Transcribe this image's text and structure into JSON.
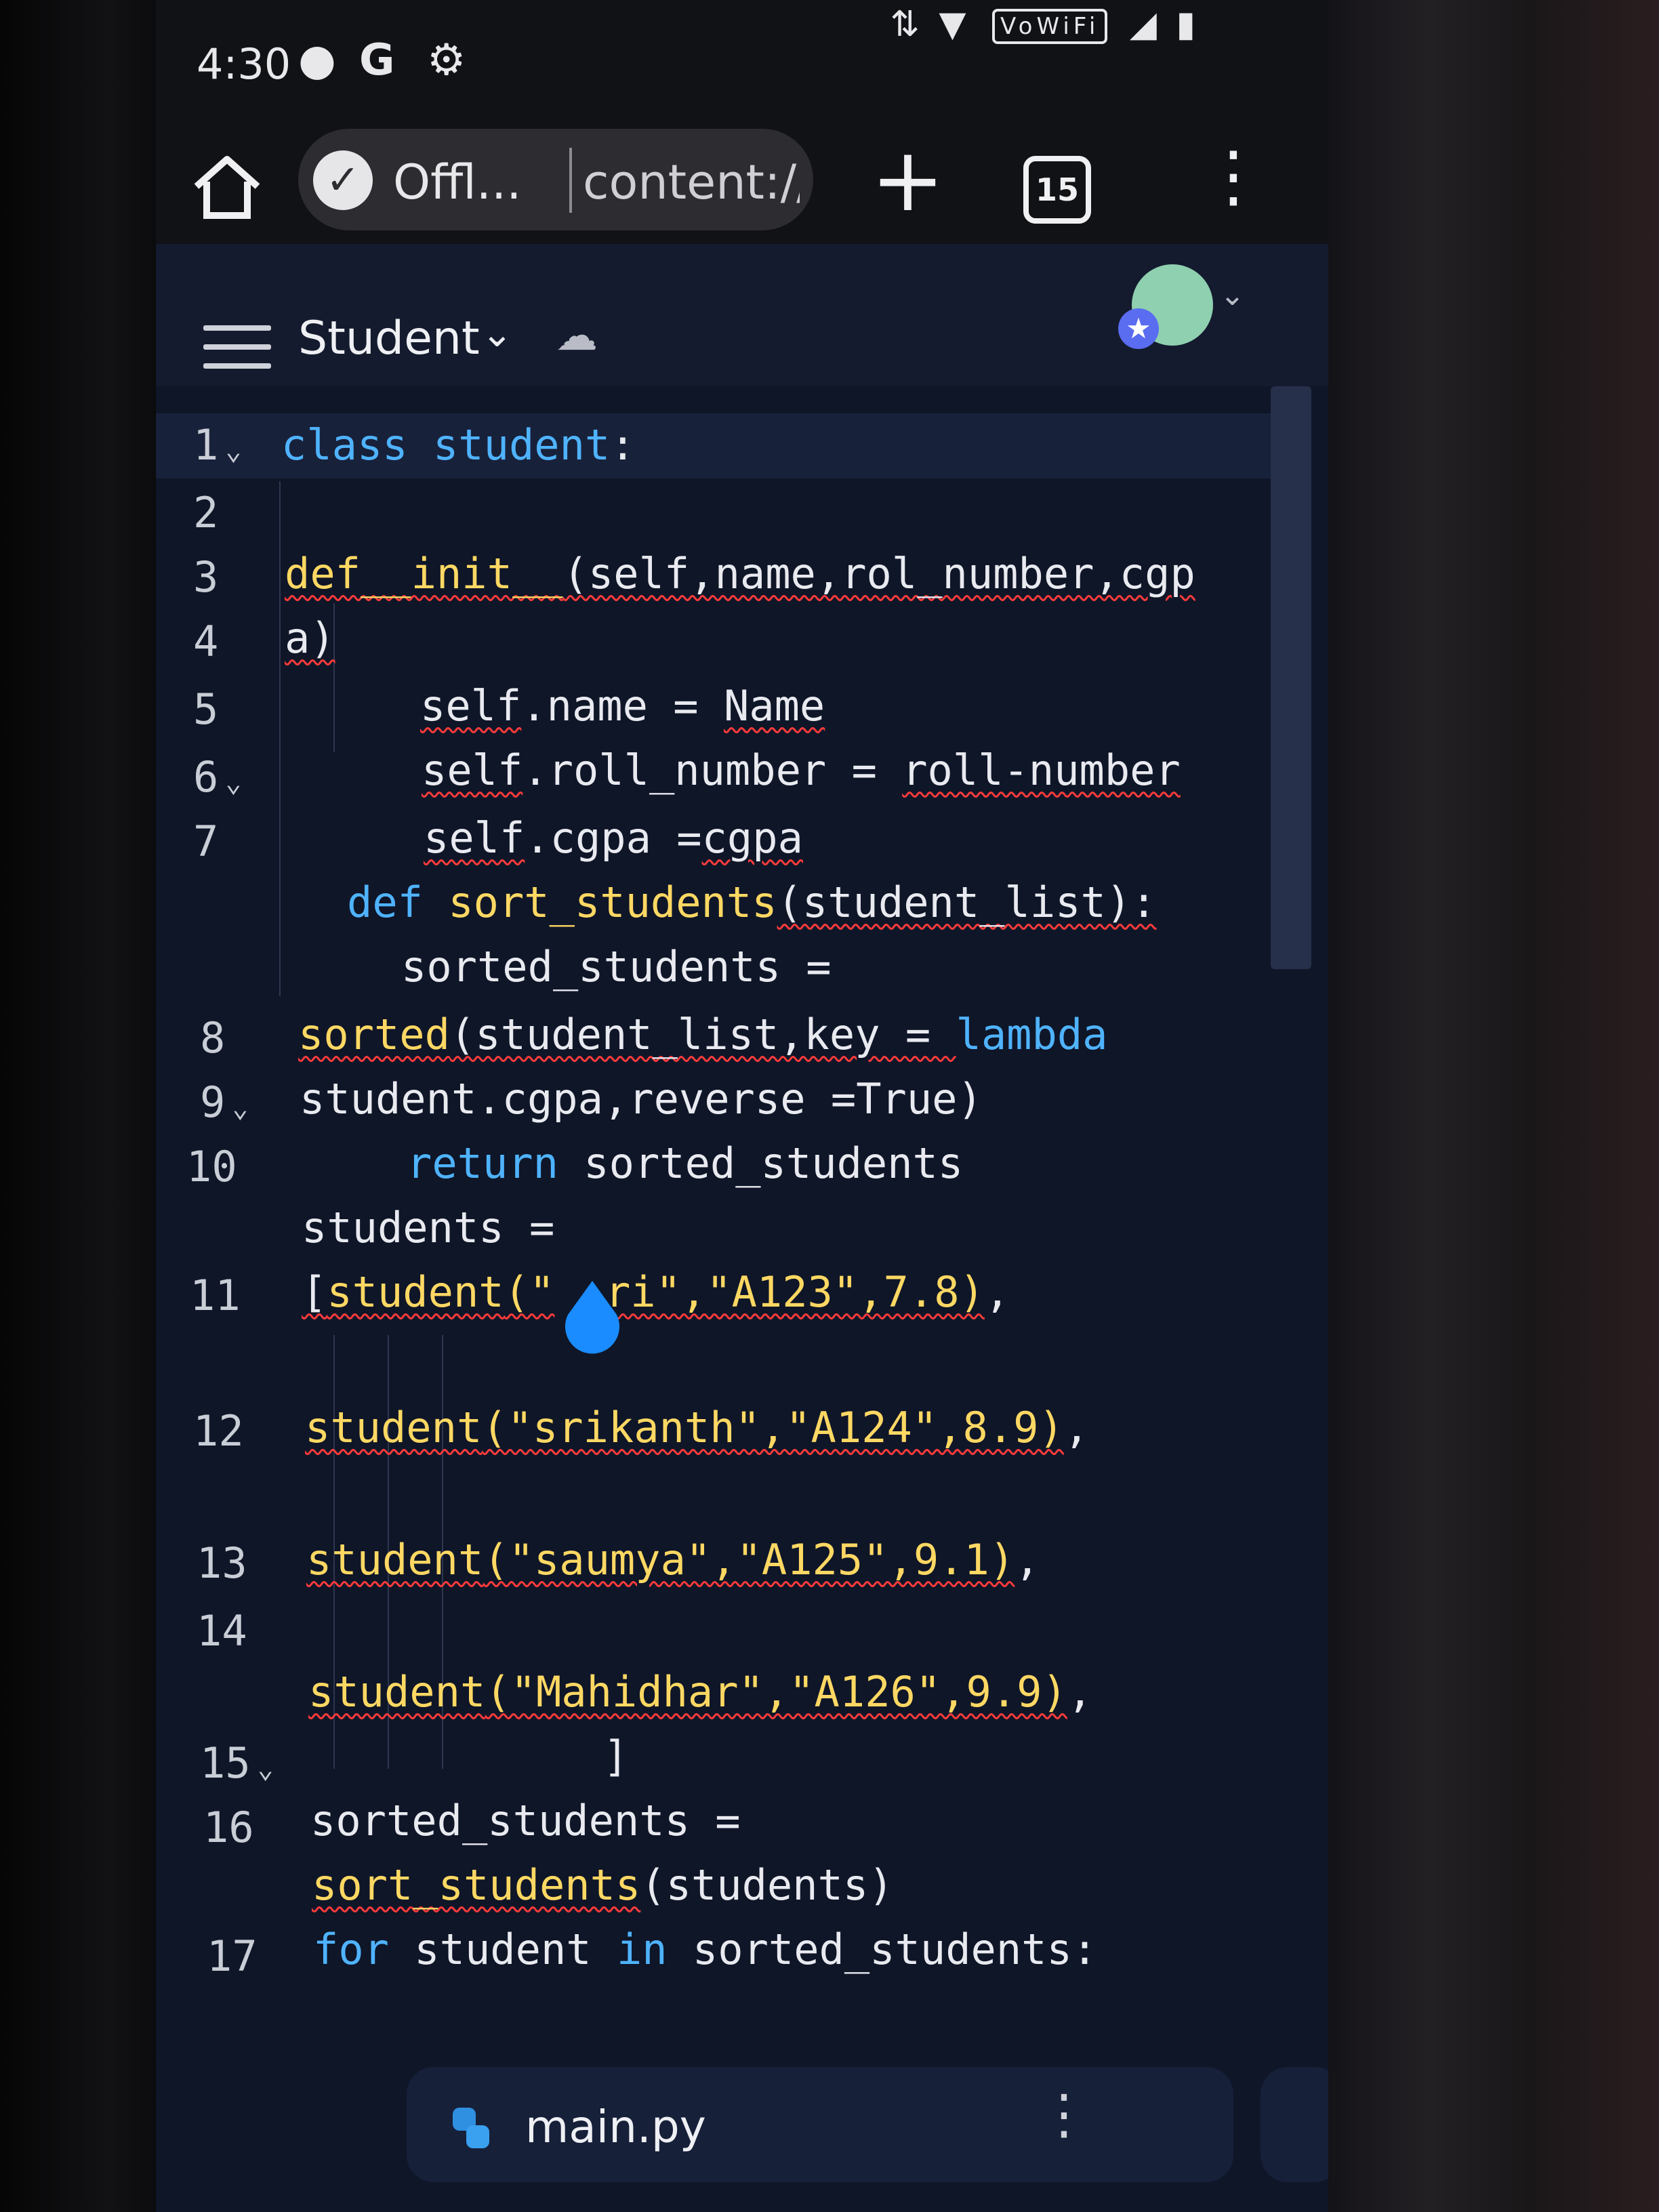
{
  "status_bar": {
    "time": "4:30",
    "icons": [
      "chat-bubble-icon",
      "google-icon",
      "gear-icon"
    ],
    "vowifi": "VoWiFi"
  },
  "browser": {
    "offline_label": "Offl...",
    "url": "content://",
    "tab_count": "15"
  },
  "app": {
    "title": "Student"
  },
  "editor": {
    "line_numbers": [
      "1",
      "2",
      "3",
      "4",
      "5",
      "6",
      "7",
      "8",
      "9",
      "10",
      "11",
      "12",
      "13",
      "14",
      "15",
      "16",
      "17"
    ],
    "code_lines": {
      "l1_kw": "class",
      "l1_name": "student",
      "l1_end": ":",
      "l3_def": "def__init__",
      "l3_rest": "(self,name,rol_number,cgp",
      "l4": "a)",
      "l5_a": "self",
      "l5_b": ".name = ",
      "l5_c": "Name",
      "l6_a": "self",
      "l6_b": ".roll_number = ",
      "l6_c": "roll-number",
      "l7_a": "self",
      "l7_b": ".cgpa =",
      "l7_c": "cgpa",
      "l7b_kw": "def",
      "l7b_fn": "sort_students",
      "l7b_args": "(student_list):",
      "l7c": "sorted_students =",
      "l8_fn": "sorted",
      "l8_args": "(student_list,key = ",
      "l8_kw": "lambda",
      "l9": "student.cgpa,reverse =True)",
      "l10_kw": "return",
      "l10_rest": " sorted_students",
      "l10b": "students =",
      "l11_pre": "[",
      "l11_fn": "student",
      "l11_str": "(\"",
      "l11_str2": "ri\",\"A123\",7.8)",
      "l11_end": ",",
      "l12_fn": "student",
      "l12_str": "(\"srikanth\",\"A124\",8.9)",
      "l12_end": ",",
      "l13_fn": "student",
      "l13_str": "(\"saumya\",\"A125\",9.1)",
      "l13_end": ",",
      "l14_fn": "student",
      "l14_str": "(\"Mahidhar\",\"A126\",9.9)",
      "l14_end": ",",
      "l15": "]",
      "l16": "sorted_students =",
      "l16b_fn": "sort_students",
      "l16b_rest": "(students)",
      "l17_kw1": "for",
      "l17_a": " student ",
      "l17_kw2": "in",
      "l17_b": " sorted_students:"
    }
  },
  "bottom_tab": {
    "file_name": "main.py"
  },
  "colors": {
    "keyword": "#4fb3ff",
    "function": "#ffd863",
    "error_underline": "#ff3b3b",
    "editor_bg": "#0f1628"
  }
}
